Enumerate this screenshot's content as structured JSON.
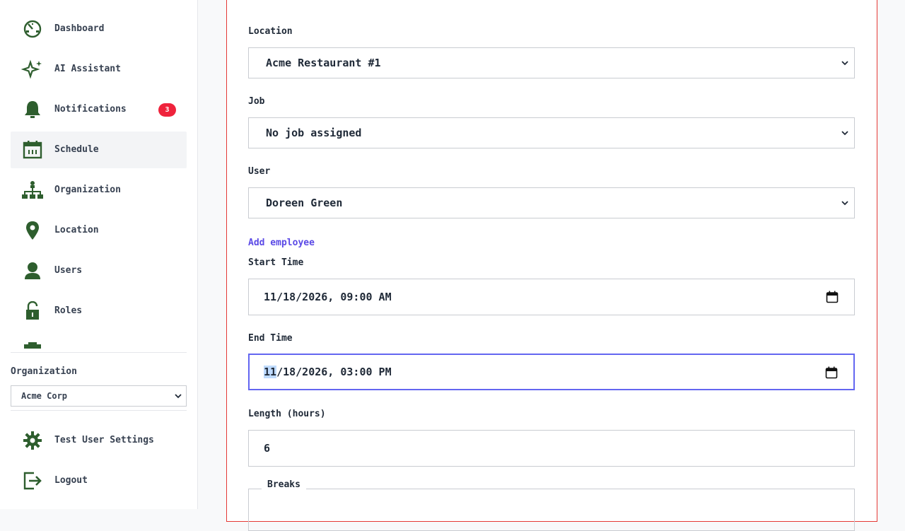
{
  "sidebar": {
    "nav_items": [
      {
        "label": "Dashboard",
        "icon": "dashboard-icon"
      },
      {
        "label": "AI Assistant",
        "icon": "sparkle-icon"
      },
      {
        "label": "Notifications",
        "icon": "bell-icon",
        "badge": "3"
      },
      {
        "label": "Schedule",
        "icon": "calendar-icon",
        "active": true
      },
      {
        "label": "Organization",
        "icon": "org-chart-icon"
      },
      {
        "label": "Location",
        "icon": "map-pin-icon"
      },
      {
        "label": "Users",
        "icon": "user-icon"
      },
      {
        "label": "Roles",
        "icon": "lock-icon"
      }
    ],
    "organization": {
      "label": "Organization",
      "selected": "Acme Corp"
    },
    "footer": {
      "settings_label": "Test User Settings",
      "logout_label": "Logout"
    }
  },
  "form": {
    "location": {
      "label": "Location",
      "value": "Acme Restaurant #1"
    },
    "job": {
      "label": "Job",
      "value": "No job assigned"
    },
    "user": {
      "label": "User",
      "value": "Doreen Green"
    },
    "add_employee_label": "Add employee",
    "start_time": {
      "label": "Start Time",
      "value": "11/18/2026, 09:00 AM"
    },
    "end_time": {
      "label": "End Time",
      "month": "11",
      "rest": "/18/2026, 03:00 PM"
    },
    "length": {
      "label": "Length (hours)",
      "value": "6"
    },
    "breaks_legend": "Breaks"
  },
  "colors": {
    "icon_green": "#2e5e2e",
    "panel_border": "#e53935",
    "focus_ring": "#6366f1",
    "badge": "#ef233c",
    "link": "#5b4ae6"
  }
}
